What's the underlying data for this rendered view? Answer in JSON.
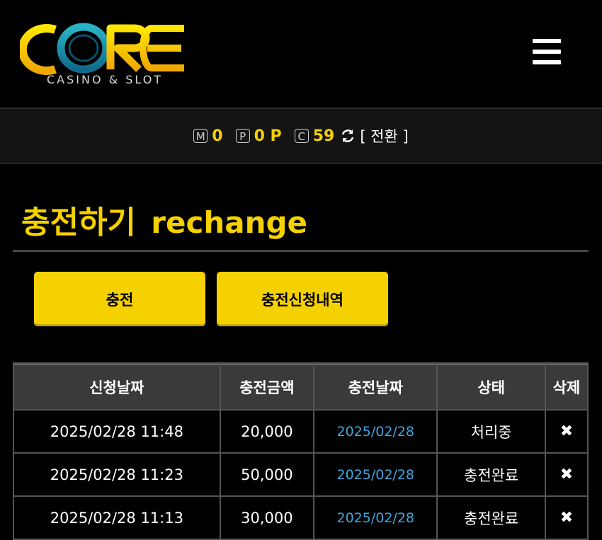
{
  "brand": {
    "name": "CORE",
    "tagline": "CASINO & SLOT"
  },
  "points": {
    "money_badge": "M",
    "money_value": "0",
    "point_badge": "P",
    "point_value": "0 P",
    "coin_badge": "C",
    "coin_value": "59",
    "switch_label": "[ 전환 ]"
  },
  "page": {
    "title": "충전하기",
    "subtitle": "rechange"
  },
  "buttons": {
    "charge": "충전",
    "history": "충전신청내역"
  },
  "table": {
    "headers": [
      "신청날짜",
      "충전금액",
      "충전날짜",
      "상태",
      "삭제"
    ],
    "rows": [
      {
        "requested": "2025/02/28 11:48",
        "amount": "20,000",
        "charged": "2025/02/28",
        "status": "처리중",
        "delete": "✖"
      },
      {
        "requested": "2025/02/28 11:23",
        "amount": "50,000",
        "charged": "2025/02/28",
        "status": "충전완료",
        "delete": "✖"
      },
      {
        "requested": "2025/02/28 11:13",
        "amount": "30,000",
        "charged": "2025/02/28",
        "status": "충전완료",
        "delete": "✖"
      }
    ]
  },
  "colors": {
    "accent": "#f5d100",
    "link": "#3fa7e0",
    "background": "#000000"
  }
}
